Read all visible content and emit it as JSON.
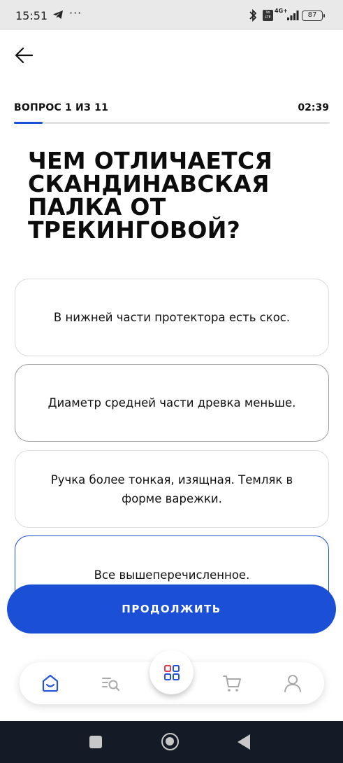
{
  "status_bar": {
    "time": "15:51",
    "dots": "···",
    "volte": "Vo LTE",
    "network": "4G+",
    "battery": "87"
  },
  "quiz": {
    "progress_label": "ВОПРОС 1 ИЗ 11",
    "progress_fraction": 0.0909,
    "timer": "02:39",
    "question": "ЧЕМ ОТЛИЧАЕТСЯ СКАНДИНАВСКАЯ ПАЛКА ОТ ТРЕКИНГОВОЙ?",
    "answers": [
      "В нижней части протектора есть скос.",
      "Диаметр средней части древка меньше.",
      "Ручка более тонкая, изящная. Темляк в форме варежки.",
      "Все вышеперечисленное."
    ],
    "continue_label": "ПРОДОЛЖИТЬ"
  },
  "tabbar": {
    "icons": [
      "home-icon",
      "search-list-icon",
      "catalog-grid-icon",
      "cart-icon",
      "profile-icon"
    ]
  },
  "colors": {
    "accent": "#1b50d6",
    "catalog_blue": "#2554d6",
    "catalog_red": "#e03a4a"
  }
}
